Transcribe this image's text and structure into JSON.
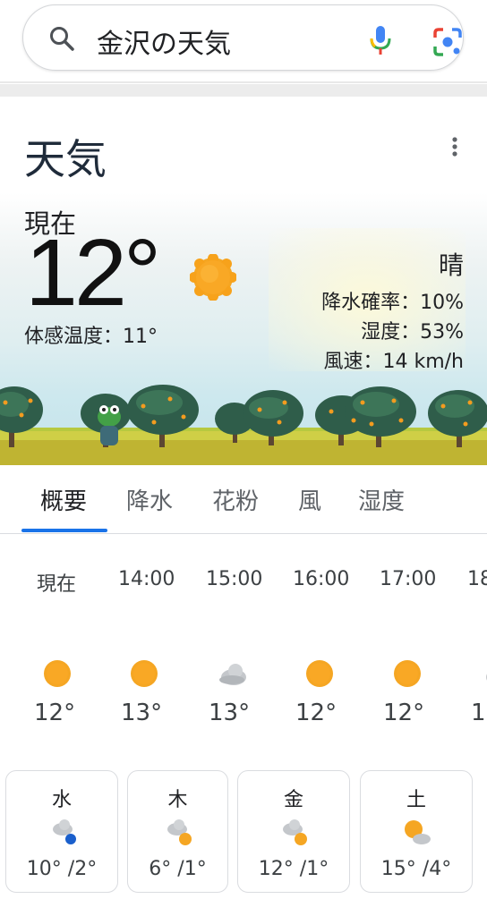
{
  "search": {
    "query": "金沢の天気",
    "icons": [
      "search-icon",
      "mic-icon",
      "lens-icon"
    ]
  },
  "card": {
    "title": "天気",
    "now_label": "現在",
    "temperature": "12°",
    "feels_like": "体感温度：11°",
    "condition": "晴",
    "precip": "降水確率：10%",
    "humidity": "湿度：53%",
    "wind": "風速：14 km/h"
  },
  "tabs": [
    {
      "label": "概要",
      "active": true
    },
    {
      "label": "降水",
      "active": false
    },
    {
      "label": "花粉",
      "active": false
    },
    {
      "label": "風",
      "active": false
    },
    {
      "label": "湿度",
      "active": false
    }
  ],
  "hourly": [
    {
      "time": "現在",
      "icon": "sun-icon",
      "temp": "12°"
    },
    {
      "time": "14:00",
      "icon": "sun-icon",
      "temp": "13°"
    },
    {
      "time": "15:00",
      "icon": "cloud-icon",
      "temp": "13°"
    },
    {
      "time": "16:00",
      "icon": "sun-icon",
      "temp": "12°"
    },
    {
      "time": "17:00",
      "icon": "sun-icon",
      "temp": "12°"
    },
    {
      "time": "18",
      "icon": "cloud-icon",
      "temp": "1"
    }
  ],
  "daily": [
    {
      "day": "水",
      "icon": "cloud-rain-icon",
      "temps": "10° /2°"
    },
    {
      "day": "木",
      "icon": "cloud-sun-icon",
      "temps": "6° /1°"
    },
    {
      "day": "金",
      "icon": "cloud-sun-icon",
      "temps": "12° /1°"
    },
    {
      "day": "土",
      "icon": "sun-cloud-icon",
      "temps": "15° /4°"
    }
  ],
  "colors": {
    "accent": "#1a73e8",
    "sun": "#f9a825",
    "title": "#1f2b3a"
  }
}
